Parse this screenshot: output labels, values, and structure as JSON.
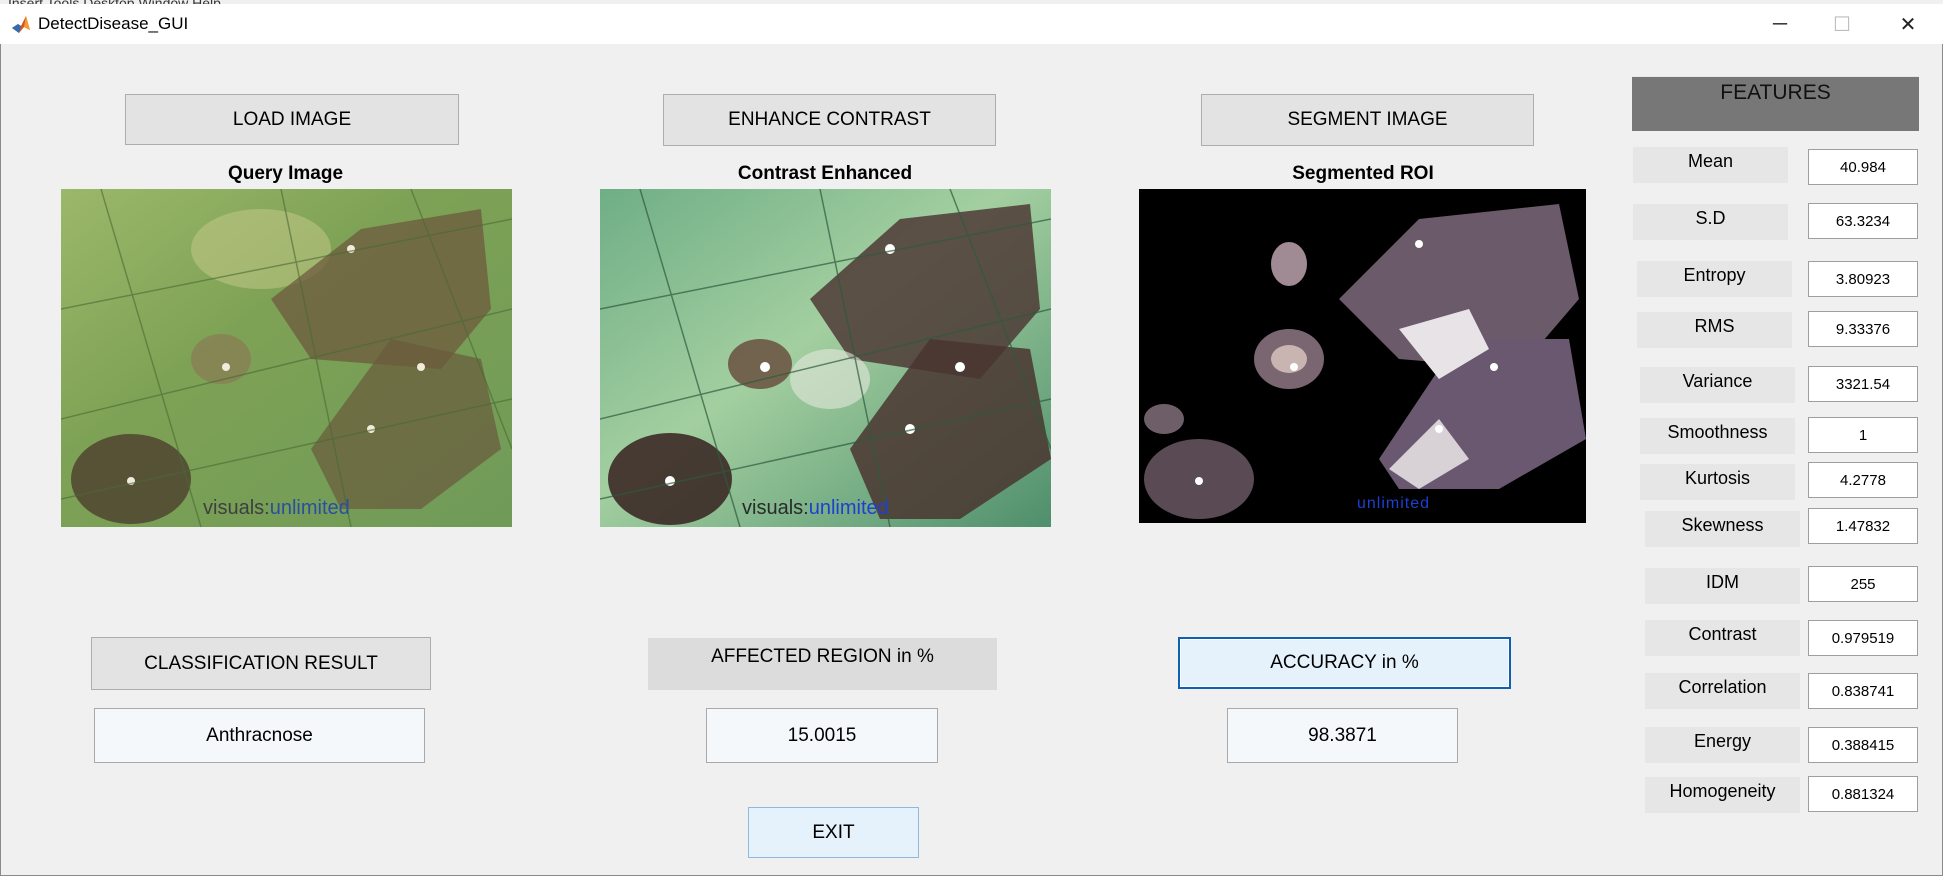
{
  "window": {
    "title": "DetectDisease_GUI",
    "menu_ghost": "Insert  Tools  Desktop  Window  Help",
    "minimize": "─",
    "maximize": "☐",
    "close": "✕"
  },
  "toolbar": {
    "load_image": "LOAD IMAGE",
    "enhance_contrast": "ENHANCE CONTRAST",
    "segment_image": "SEGMENT IMAGE"
  },
  "panels": {
    "query_caption": "Query Image",
    "enhanced_caption": "Contrast Enhanced",
    "segmented_caption": "Segmented ROI",
    "watermark_prefix": "visuals:",
    "watermark_suffix": "unlimited",
    "segmented_watermark": "unlimited"
  },
  "results": {
    "classification_label": "CLASSIFICATION RESULT",
    "classification_value": "Anthracnose",
    "affected_label": "AFFECTED REGION in %",
    "affected_value": "15.0015",
    "accuracy_label": "ACCURACY in %",
    "accuracy_value": "98.3871",
    "exit_label": "EXIT"
  },
  "features": {
    "header": "FEATURES",
    "items": [
      {
        "label": "Mean",
        "value": "40.984"
      },
      {
        "label": "S.D",
        "value": "63.3234"
      },
      {
        "label": "Entropy",
        "value": "3.80923"
      },
      {
        "label": "RMS",
        "value": "9.33376"
      },
      {
        "label": "Variance",
        "value": "3321.54"
      },
      {
        "label": "Smoothness",
        "value": "1"
      },
      {
        "label": "Kurtosis",
        "value": "4.2778"
      },
      {
        "label": "Skewness",
        "value": "1.47832"
      },
      {
        "label": "IDM",
        "value": "255"
      },
      {
        "label": "Contrast",
        "value": "0.979519"
      },
      {
        "label": "Correlation",
        "value": "0.838741"
      },
      {
        "label": "Energy",
        "value": "0.388415"
      },
      {
        "label": "Homogeneity",
        "value": "0.881324"
      }
    ]
  },
  "colors": {
    "leaf_green": "#7fa65a",
    "lesion_brown": "#5b4335",
    "focus_blue": "#0f5fb2",
    "features_header": "#777777"
  }
}
